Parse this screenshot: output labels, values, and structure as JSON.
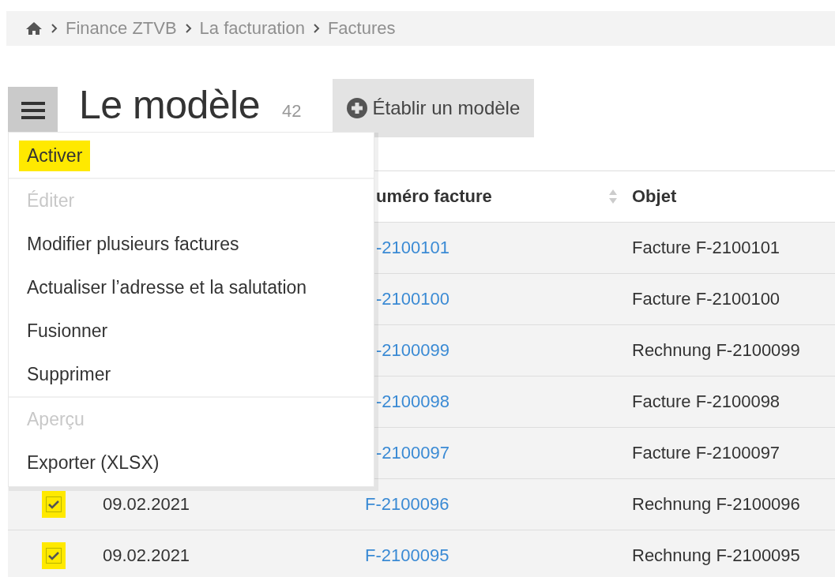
{
  "breadcrumb": [
    {
      "label": "Finance ZTVB"
    },
    {
      "label": "La facturation"
    },
    {
      "label": "Factures"
    }
  ],
  "title": "Le modèle",
  "count": "42",
  "create_button": {
    "label": "Établir un modèle"
  },
  "menu": {
    "items": [
      {
        "kind": "item",
        "label": "Activer",
        "disabled": false,
        "highlighted": true
      },
      {
        "kind": "separator"
      },
      {
        "kind": "item",
        "label": "Éditer",
        "disabled": true,
        "highlighted": false
      },
      {
        "kind": "item",
        "label": "Modifier plusieurs factures",
        "disabled": false,
        "highlighted": false
      },
      {
        "kind": "item",
        "label": "Actualiser l’adresse et la salutation",
        "disabled": false,
        "highlighted": false
      },
      {
        "kind": "item",
        "label": "Fusionner",
        "disabled": false,
        "highlighted": false
      },
      {
        "kind": "item",
        "label": "Supprimer",
        "disabled": false,
        "highlighted": false
      },
      {
        "kind": "separator"
      },
      {
        "kind": "item",
        "label": "Aperçu",
        "disabled": true,
        "highlighted": false
      },
      {
        "kind": "item",
        "label": "Exporter (XLSX)",
        "disabled": false,
        "highlighted": false
      }
    ]
  },
  "table": {
    "columns": [
      {
        "label": "uméro facture",
        "sortable": true
      },
      {
        "label": "Objet",
        "sortable": false
      }
    ],
    "rows": [
      {
        "number": "-2100101",
        "object": "Facture F-2100101"
      },
      {
        "number": "-2100100",
        "object": "Facture F-2100100"
      },
      {
        "number": "-2100099",
        "object": "Rechnung F-2100099"
      },
      {
        "number": "-2100098",
        "object": "Facture F-2100098"
      },
      {
        "number": "-2100097",
        "object": "Facture F-2100097"
      },
      {
        "checked": true,
        "highlighted": true,
        "date": "09.02.2021",
        "number": "F-2100096",
        "object": "Rechnung F-2100096"
      },
      {
        "checked": true,
        "highlighted": true,
        "date": "09.02.2021",
        "number": "F-2100095",
        "object": "Rechnung F-2100095"
      }
    ]
  }
}
